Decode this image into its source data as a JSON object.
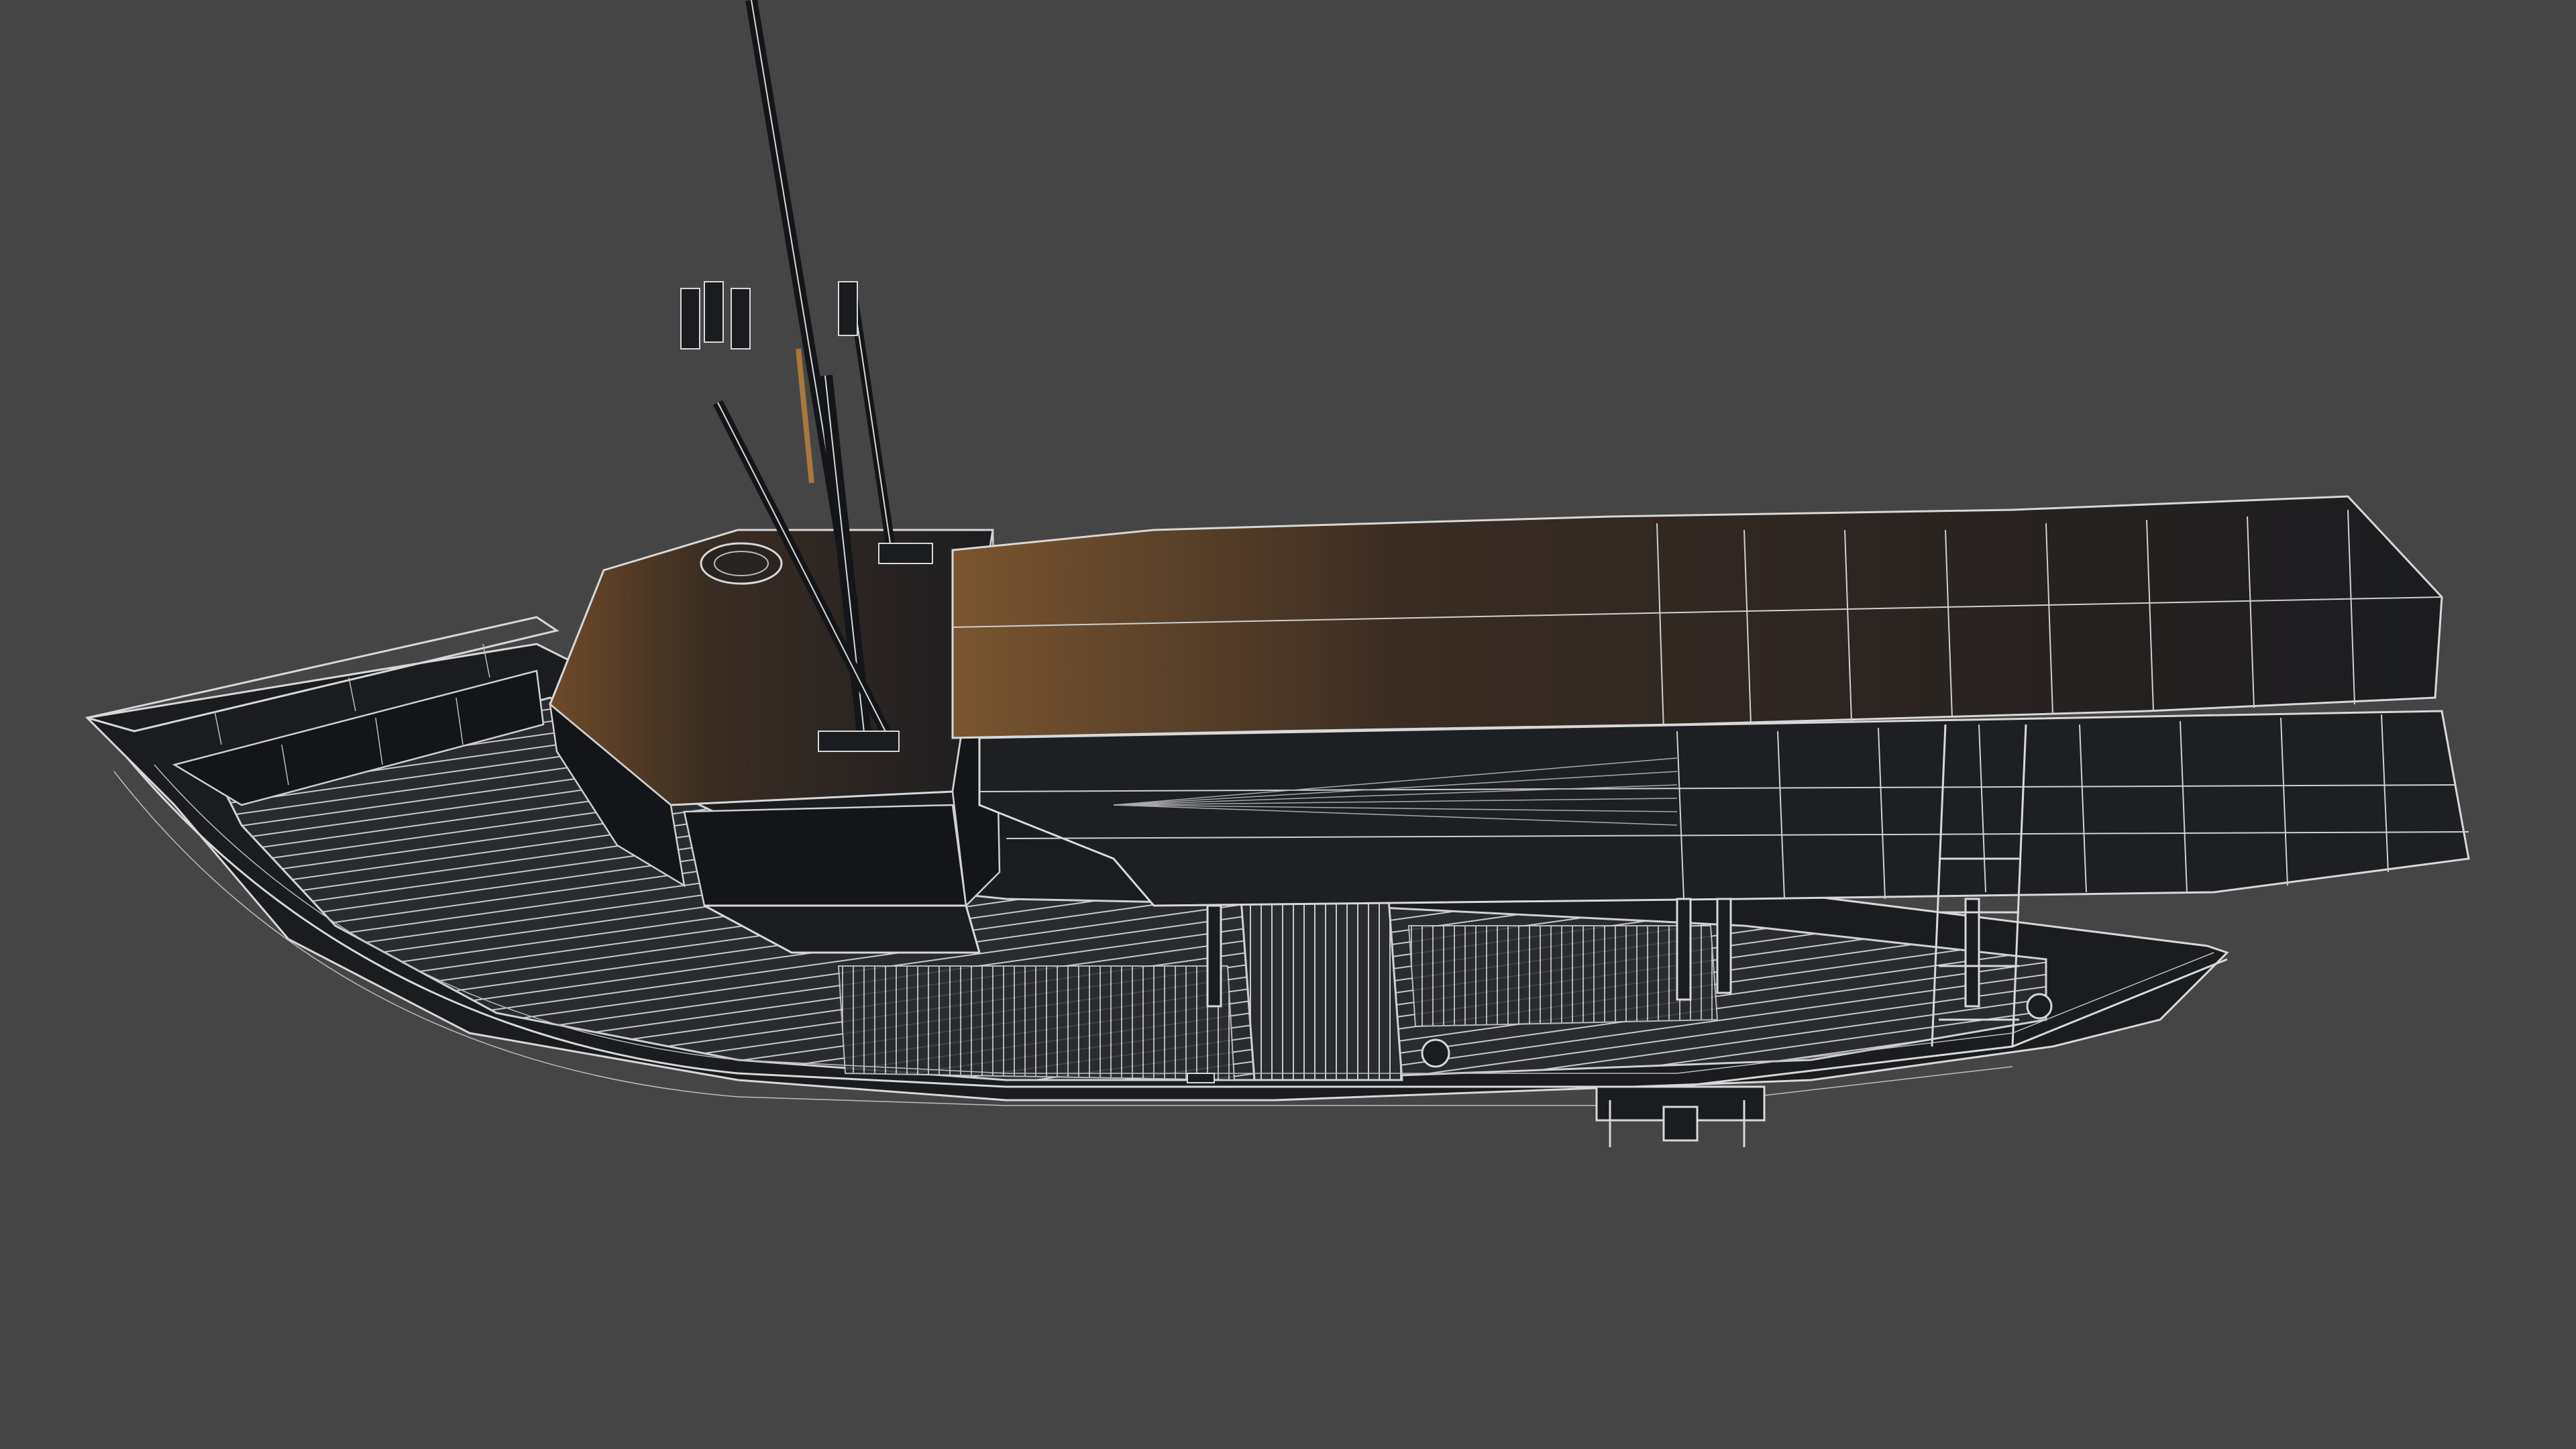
{
  "scene": {
    "background_color": "#454545",
    "subject": "boat-wireframe-render",
    "palette": {
      "hull": "#1b1c20",
      "deck": "#2a2b2f",
      "wire": "#d8d8d8",
      "accent_bronze": "#7a5530"
    }
  }
}
